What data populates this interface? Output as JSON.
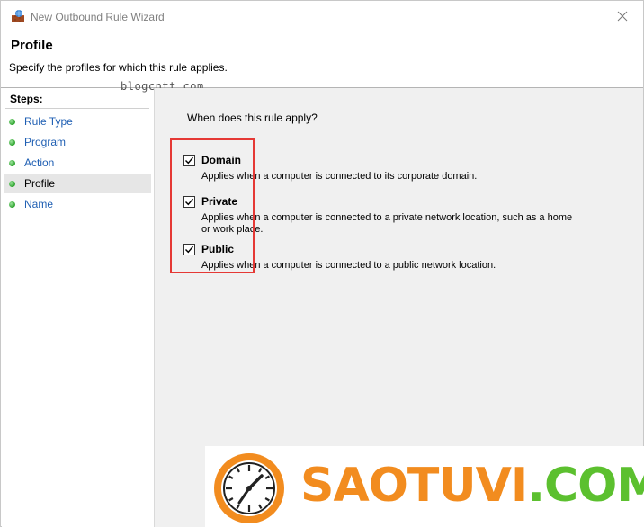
{
  "window": {
    "title": "New Outbound Rule Wizard"
  },
  "header": {
    "title": "Profile",
    "subtitle": "Specify the profiles for which this rule applies."
  },
  "watermark": "blogcntt.com",
  "sidebar": {
    "steps_label": "Steps:",
    "items": [
      {
        "label": "Rule Type",
        "active": false
      },
      {
        "label": "Program",
        "active": false
      },
      {
        "label": "Action",
        "active": false
      },
      {
        "label": "Profile",
        "active": true
      },
      {
        "label": "Name",
        "active": false
      }
    ]
  },
  "content": {
    "question": "When does this rule apply?",
    "options": [
      {
        "label": "Domain",
        "checked": true,
        "description": "Applies when a computer is connected to its corporate domain."
      },
      {
        "label": "Private",
        "checked": true,
        "description": "Applies when a computer is connected to a private network location, such as a home or work place."
      },
      {
        "label": "Public",
        "checked": true,
        "description": "Applies when a computer is connected to a public network location."
      }
    ]
  },
  "banner": {
    "brand_part1": "SAOTUVI",
    "brand_part2": ".COM"
  },
  "colors": {
    "highlight": "#e53935",
    "link": "#1f5fb3",
    "brand_orange": "#f28c1f",
    "brand_green": "#5cc02f"
  }
}
